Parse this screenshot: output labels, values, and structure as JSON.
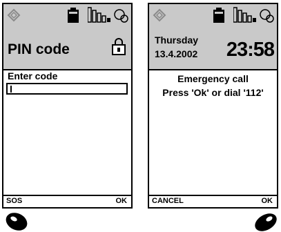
{
  "left_screen": {
    "title": "PIN code",
    "prompt": "Enter code",
    "input_value": "",
    "softkey_left": "SOS",
    "softkey_right": "OK",
    "icons": [
      "diamond-icon",
      "battery-icon",
      "signal-icon",
      "lock-icon"
    ]
  },
  "right_screen": {
    "day": "Thursday",
    "date": "13.4.2002",
    "time": "23:58",
    "message_line1": "Emergency call",
    "message_line2": "Press 'Ok' or dial '112'",
    "softkey_left": "CANCEL",
    "softkey_right": "OK",
    "icons": [
      "diamond-icon",
      "battery-icon",
      "signal-icon"
    ]
  },
  "colors": {
    "header_background": "#c9c9c9",
    "screen_background": "#ffffff",
    "ink": "#000000"
  }
}
